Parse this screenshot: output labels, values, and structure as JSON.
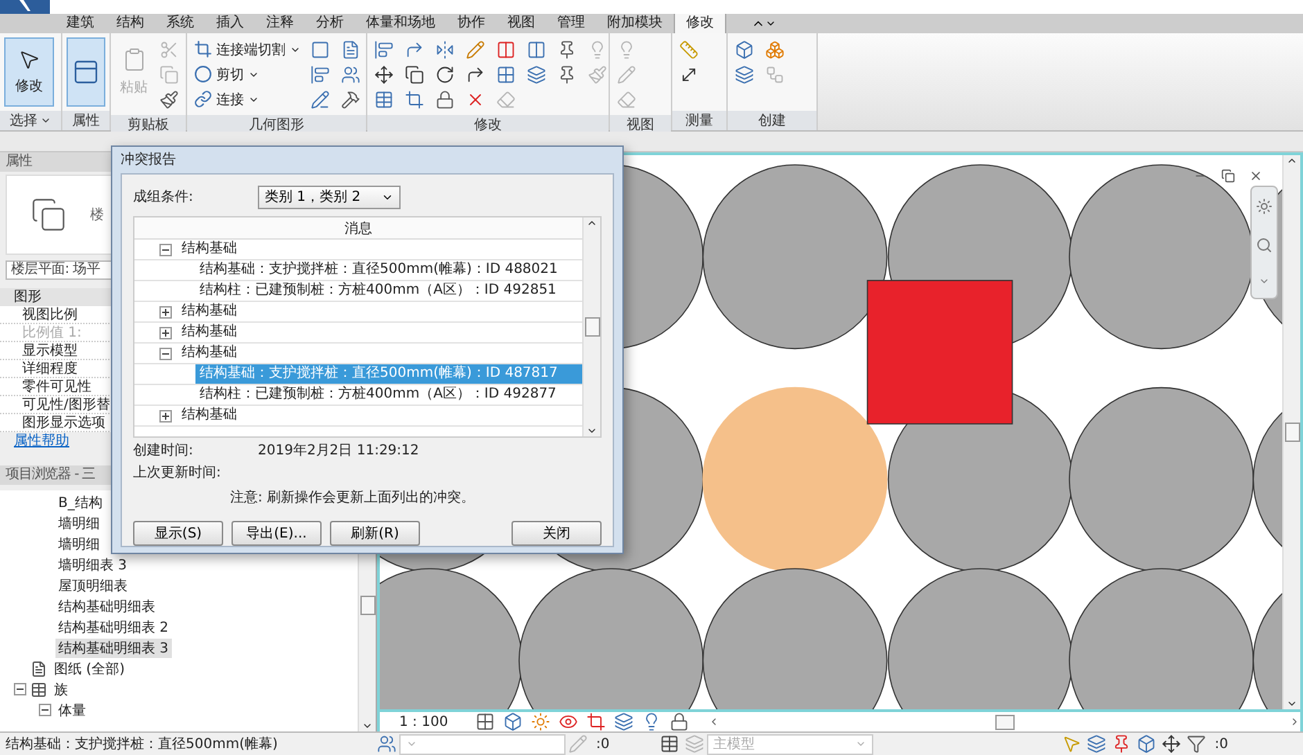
{
  "ribbon": {
    "tabs": [
      {
        "label": "建筑",
        "selected": false
      },
      {
        "label": "结构",
        "selected": false
      },
      {
        "label": "系统",
        "selected": false
      },
      {
        "label": "插入",
        "selected": false
      },
      {
        "label": "注释",
        "selected": false
      },
      {
        "label": "分析",
        "selected": false
      },
      {
        "label": "体量和场地",
        "selected": false
      },
      {
        "label": "协作",
        "selected": false
      },
      {
        "label": "视图",
        "selected": false
      },
      {
        "label": "管理",
        "selected": false
      },
      {
        "label": "附加模块",
        "selected": false
      },
      {
        "label": "修改",
        "selected": true
      }
    ],
    "groups": [
      {
        "kind": "select",
        "label": "选择",
        "dropdown": true,
        "tools": [
          {
            "label": "修改",
            "selected": true
          }
        ]
      },
      {
        "kind": "properties",
        "label": "属性",
        "dropdown": false
      },
      {
        "kind": "clipboard",
        "label": "剪贴板",
        "dropdown": false,
        "tools": [
          {
            "label": "粘贴",
            "disabled": true
          }
        ]
      },
      {
        "kind": "geometry",
        "label": "几何图形",
        "dropdown": false,
        "tools": [
          {
            "label": "连接端切割"
          },
          {
            "label": "剪切"
          },
          {
            "label": "连接"
          }
        ]
      },
      {
        "kind": "modify",
        "label": "修改",
        "dropdown": false
      },
      {
        "kind": "view",
        "label": "视图",
        "dropdown": false
      },
      {
        "kind": "measure",
        "label": "测量",
        "dropdown": false
      },
      {
        "kind": "create",
        "label": "创建",
        "dropdown": false
      }
    ]
  },
  "properties": {
    "title": "属性",
    "type_name": "楼",
    "view_selector": "楼层平面: 场平",
    "section": "图形",
    "rows": [
      {
        "label": "视图比例",
        "disabled": false
      },
      {
        "label": "比例值 1:",
        "disabled": true
      },
      {
        "label": "显示模型",
        "disabled": false
      },
      {
        "label": "详细程度",
        "disabled": false
      },
      {
        "label": "零件可见性",
        "disabled": false
      },
      {
        "label": "可见性/图形替",
        "disabled": false
      },
      {
        "label": "图形显示选项",
        "disabled": false
      }
    ],
    "help_link": "属性帮助"
  },
  "project_browser": {
    "title": "项目浏览器 - 三",
    "schedules": [
      {
        "label": "B_结构",
        "selected": false
      },
      {
        "label": "墙明细",
        "selected": false
      },
      {
        "label": "墙明细",
        "selected": false
      },
      {
        "label": "墙明细表 3",
        "selected": false
      },
      {
        "label": "屋顶明细表",
        "selected": false
      },
      {
        "label": "结构基础明细表",
        "selected": false
      },
      {
        "label": "结构基础明细表 2",
        "selected": false
      },
      {
        "label": "结构基础明细表 3",
        "selected": true
      }
    ],
    "nodes": [
      {
        "label": "图纸 (全部)",
        "kind": "sheets"
      },
      {
        "label": "族",
        "kind": "family",
        "expanded": true,
        "children": [
          {
            "label": "体量",
            "expanded": true
          }
        ]
      }
    ]
  },
  "view_bar": {
    "scale": "1 : 100"
  },
  "status_bar": {
    "message": "结构基础：支护搅拌桩：直径500mm(帷幕)",
    "workset_count": ":0",
    "design_option": "主模型",
    "filter_count": ":0"
  },
  "clash_report": {
    "title": "冲突报告",
    "group_by_label": "成组条件:",
    "group_by_value": "类别 1，类别 2",
    "column_header": "消息",
    "groups": [
      {
        "label": "结构基础",
        "expanded": true,
        "children": [
          {
            "label": "结构基础：支护搅拌桩：直径500mm(帷幕)：ID 488021",
            "selected": false
          },
          {
            "label": "结构柱：已建预制桩：方桩400mm（A区）：ID 492851",
            "selected": false
          }
        ]
      },
      {
        "label": "结构基础",
        "expanded": false
      },
      {
        "label": "结构基础",
        "expanded": false
      },
      {
        "label": "结构基础",
        "expanded": true,
        "children": [
          {
            "label": "结构基础：支护搅拌桩：直径500mm(帷幕)：ID 487817",
            "selected": true
          },
          {
            "label": "结构柱：已建预制桩：方桩400mm（A区）：ID 492877",
            "selected": false
          }
        ]
      },
      {
        "label": "结构基础",
        "expanded": false
      }
    ],
    "created_label": "创建时间:",
    "created_value": "2019年2月2日  11:29:12",
    "updated_label": "上次更新时间:",
    "note": "注意: 刷新操作会更新上面列出的冲突。",
    "buttons": [
      {
        "label": "显示(S)"
      },
      {
        "label": "导出(E)..."
      },
      {
        "label": "刷新(R)"
      },
      {
        "label": "关闭"
      }
    ]
  }
}
